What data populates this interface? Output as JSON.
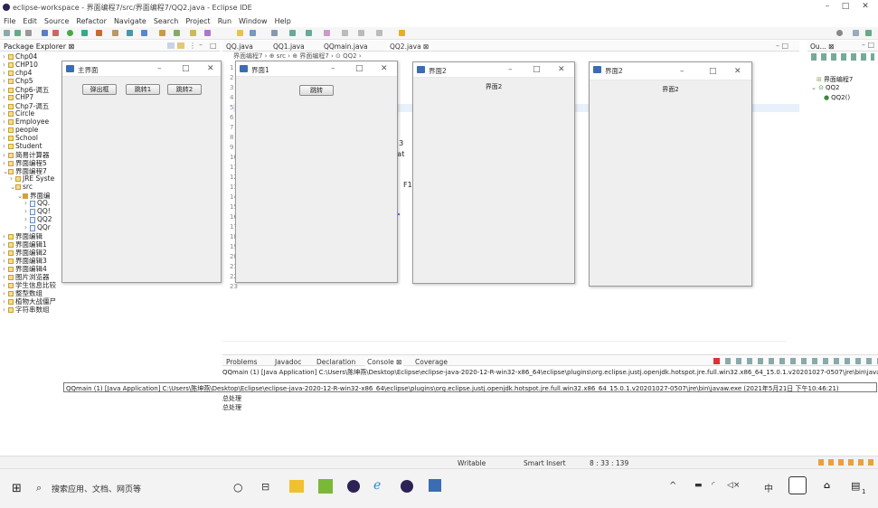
{
  "window": {
    "title": "eclipse-workspace - 界面编程7/src/界面编程7/QQ2.java - Eclipse IDE",
    "min": "–",
    "max": "□",
    "close": "✕"
  },
  "menu": [
    "File",
    "Edit",
    "Source",
    "Refactor",
    "Navigate",
    "Search",
    "Project",
    "Run",
    "Window",
    "Help"
  ],
  "package_explorer": {
    "title": "Package Explorer ⊠",
    "items": [
      {
        "label": "Chp04",
        "kind": "project",
        "depth": 0,
        "open": false
      },
      {
        "label": "CHP10",
        "kind": "project",
        "depth": 0,
        "open": false
      },
      {
        "label": "chp4",
        "kind": "project",
        "depth": 0,
        "open": false
      },
      {
        "label": "Chp5",
        "kind": "project",
        "depth": 0,
        "open": false
      },
      {
        "label": "Chp6-调五",
        "kind": "project",
        "depth": 0,
        "open": false
      },
      {
        "label": "CHP7",
        "kind": "project",
        "depth": 0,
        "open": false
      },
      {
        "label": "Chp7-调五",
        "kind": "project",
        "depth": 0,
        "open": false
      },
      {
        "label": "Circle",
        "kind": "project",
        "depth": 0,
        "open": false
      },
      {
        "label": "Employee",
        "kind": "project",
        "depth": 0,
        "open": false
      },
      {
        "label": "people",
        "kind": "project",
        "depth": 0,
        "open": false
      },
      {
        "label": "School",
        "kind": "project",
        "depth": 0,
        "open": false
      },
      {
        "label": "Student",
        "kind": "project",
        "depth": 0,
        "open": false
      },
      {
        "label": "简易计算器",
        "kind": "project",
        "depth": 0,
        "open": false
      },
      {
        "label": "界面编程5",
        "kind": "project",
        "depth": 0,
        "open": false
      },
      {
        "label": "界面编程7",
        "kind": "project",
        "depth": 0,
        "open": true
      },
      {
        "label": "JRE Syste",
        "kind": "lib",
        "depth": 1,
        "open": false
      },
      {
        "label": "src",
        "kind": "folder",
        "depth": 1,
        "open": true
      },
      {
        "label": "界面编",
        "kind": "package",
        "depth": 2,
        "open": true
      },
      {
        "label": "QQ.",
        "kind": "java",
        "depth": 3,
        "open": false
      },
      {
        "label": "QQ!",
        "kind": "java",
        "depth": 3,
        "open": false
      },
      {
        "label": "QQ2",
        "kind": "java",
        "depth": 3,
        "open": false
      },
      {
        "label": "QQr",
        "kind": "java",
        "depth": 3,
        "open": false
      },
      {
        "label": "界面编辑",
        "kind": "project",
        "depth": 0,
        "open": false
      },
      {
        "label": "界面编辑1",
        "kind": "project",
        "depth": 0,
        "open": false
      },
      {
        "label": "界面编辑2",
        "kind": "project",
        "depth": 0,
        "open": false
      },
      {
        "label": "界面编辑3",
        "kind": "project",
        "depth": 0,
        "open": false
      },
      {
        "label": "界面编辑4",
        "kind": "project",
        "depth": 0,
        "open": false
      },
      {
        "label": "图片浏览器",
        "kind": "project",
        "depth": 0,
        "open": false
      },
      {
        "label": "学生信息比较",
        "kind": "project",
        "depth": 0,
        "open": false
      },
      {
        "label": "整型数组",
        "kind": "project",
        "depth": 0,
        "open": false
      },
      {
        "label": "植物大战僵尸",
        "kind": "project",
        "depth": 0,
        "open": false
      },
      {
        "label": "字符串数组",
        "kind": "project",
        "depth": 0,
        "open": false
      }
    ]
  },
  "editor_tabs": [
    "QQ.java",
    "QQ1.java",
    "QQmain.java",
    "QQ2.java ⊠"
  ],
  "breadcrumb": "界面编程7 › ⊕ src › ⊕ 界面编程7 › ⊙ QQ2 ›",
  "line_numbers": [
    "1",
    "2",
    "3",
    "4",
    "5",
    "6",
    "7",
    "8",
    "9",
    "10",
    "11",
    "12",
    "13",
    "14",
    "15",
    "16",
    "17",
    "18",
    "19",
    "20",
    "21",
    "22",
    "23"
  ],
  "code_fragments": [
    "{",
    ", 3",
    "rat",
    "F1",
    "(\""
  ],
  "outline": {
    "title": "Ou... ⊠",
    "items": [
      "界面编程7",
      "QQ2",
      "QQ2()"
    ]
  },
  "bottom_tabs": [
    "Problems",
    "Javadoc",
    "Declaration",
    "Console ⊠",
    "Coverage"
  ],
  "console": {
    "header": "QQmain (1) [Java Application] C:\\Users\\陈坤燕\\Desktop\\Eclipse\\eclipse-java-2020-12-R-win32-x86_64\\eclipse\\plugins\\org.eclipse.justj.openjdk.hotspot.jre.full.win32.x86_64_15.0.1.v20201027-0507\\jre\\bin\\javaw.exe",
    "lines": [
      "总处理",
      "总处理"
    ]
  },
  "tooltip": "QQmain (1) [Java Application] C:\\Users\\陈坤燕\\Desktop\\Eclipse\\eclipse-java-2020-12-R-win32-x86_64\\eclipse\\plugins\\org.eclipse.justj.openjdk.hotspot.jre.full.win32.x86_64_15.0.1.v20201027-0507\\jre\\bin\\javaw.exe (2021年5月21日 下午10:46:21)",
  "status": {
    "writable": "Writable",
    "insert": "Smart Insert",
    "position": "8 : 33 : 139"
  },
  "swing_windows": {
    "main": {
      "title": "主界面",
      "buttons": [
        "弹出框",
        "跳转1",
        "跳转2"
      ]
    },
    "w1": {
      "title": "界面1",
      "button": "跳转"
    },
    "w2a": {
      "title": "界面2",
      "label": "界面2"
    },
    "w2b": {
      "title": "界面2",
      "label": "界面2"
    }
  },
  "taskbar": {
    "search_placeholder": "搜索应用、文档、网页等",
    "ime": "中",
    "notification": "1"
  }
}
